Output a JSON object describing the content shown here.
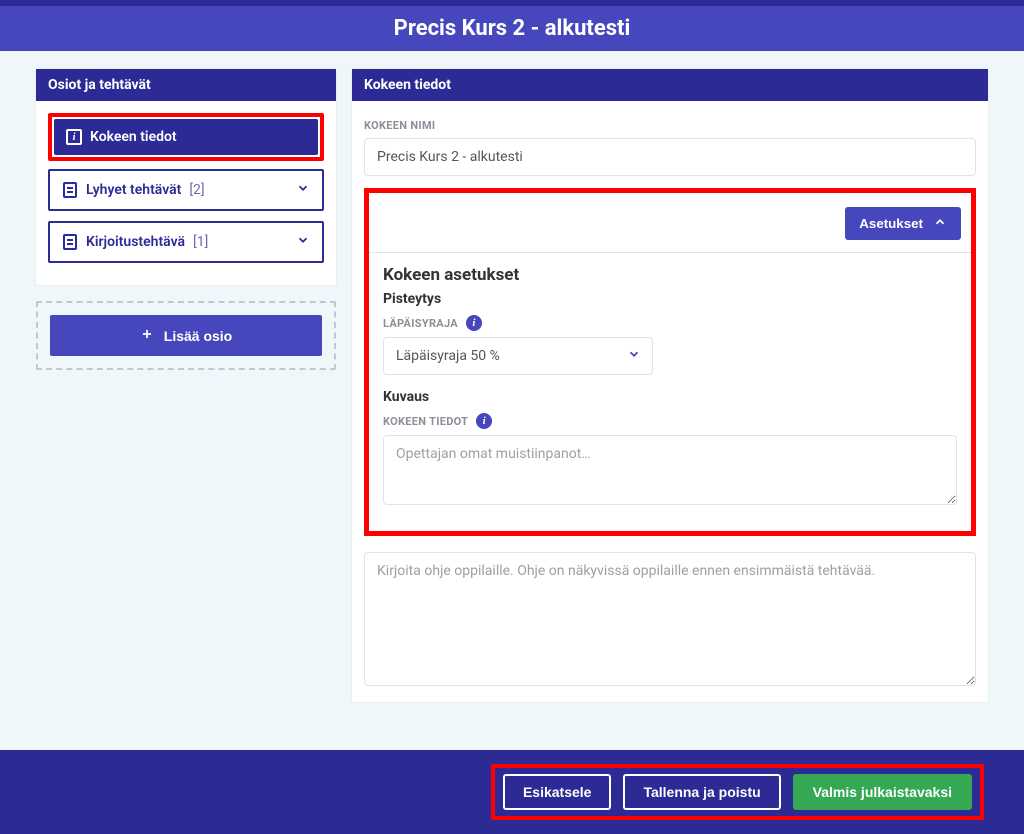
{
  "page": {
    "title": "Precis Kurs 2 - alkutesti"
  },
  "sidebar": {
    "header": "Osiot ja tehtävät",
    "items": [
      {
        "label": "Kokeen tiedot"
      },
      {
        "label": "Lyhyet tehtävät",
        "count": "[2]"
      },
      {
        "label": "Kirjoitustehtävä",
        "count": "[1]"
      }
    ],
    "add_label": "Lisää osio"
  },
  "main": {
    "header": "Kokeen tiedot",
    "name_label": "KOKEEN NIMI",
    "name_value": "Precis Kurs 2 - alkutesti",
    "settings_toggle": "Asetukset",
    "settings_heading": "Kokeen asetukset",
    "scoring_heading": "Pisteytys",
    "threshold_label": "LÄPÄISYRAJA",
    "threshold_value": "Läpäisyraja 50 %",
    "description_heading": "Kuvaus",
    "details_label": "KOKEEN TIEDOT",
    "details_placeholder": "Opettajan omat muistiinpanot…",
    "instructions_placeholder": "Kirjoita ohje oppilaille. Ohje on näkyvissä oppilaille ennen ensimmäistä tehtävää."
  },
  "footer": {
    "preview": "Esikatsele",
    "save_exit": "Tallenna ja poistu",
    "publish": "Valmis julkaistavaksi"
  }
}
